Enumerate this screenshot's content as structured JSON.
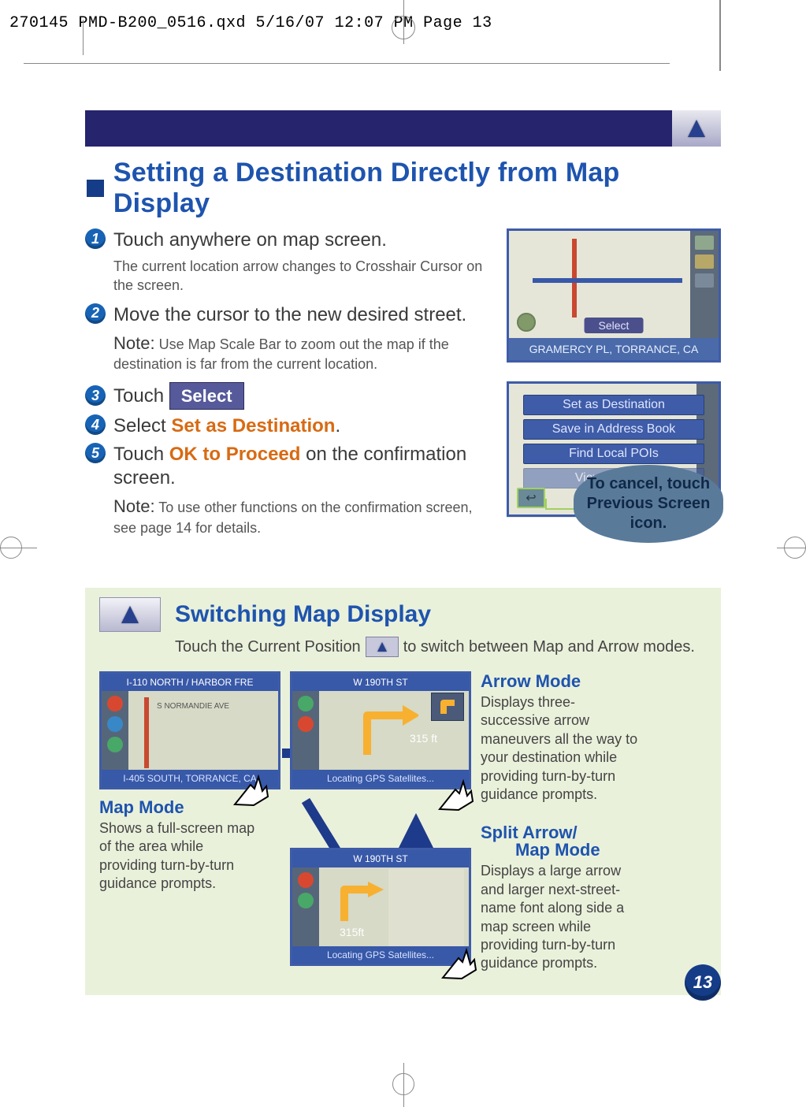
{
  "print_mark": "270145 PMD-B200_0516.qxd  5/16/07  12:07 PM  Page 13",
  "heading": "Setting a Destination Directly from Map Display",
  "steps": [
    {
      "num": "1",
      "title": "Touch anywhere on map screen.",
      "sub": "The current location arrow changes to Crosshair Cursor on the screen."
    },
    {
      "num": "2",
      "title": "Move the cursor to the new desired street.",
      "note_label": "Note:",
      "sub": "Use Map Scale Bar to zoom out the map if the destination is far from the current location."
    },
    {
      "num": "3",
      "title_pre": "Touch",
      "select_label": "Select"
    },
    {
      "num": "4",
      "title_pre": "Select",
      "orange": "Set as Destination",
      "title_post": "."
    },
    {
      "num": "5",
      "title_pre": "Touch",
      "orange": "OK to Proceed",
      "title_post": " on the confirmation screen.",
      "note_label": "Note:",
      "sub": "To use other functions on the confirmation screen, see page 14 for details."
    }
  ],
  "shot1": {
    "status": "GRAMERCY PL, TORRANCE, CA",
    "select_btn": "Select"
  },
  "shot2": {
    "menu": [
      "Set as Destination",
      "Save in Address Book",
      "Find Local POIs",
      "View Icon List"
    ],
    "callout": "To cancel, touch Previous Screen icon."
  },
  "section2": {
    "title": "Switching Map Display",
    "intro_pre": "Touch the Current Position",
    "intro_post": "to switch between Map and Arrow modes."
  },
  "map_mode": {
    "top": "I-110 NORTH / HARBOR FRE",
    "inner": "S NORMANDIE AVE",
    "bottom": "I-405 SOUTH, TORRANCE, CA",
    "label": "Map Mode",
    "desc": "Shows a full-screen map of the area while providing turn-by-turn guidance prompts."
  },
  "arrow_mode": {
    "top": "W 190TH ST",
    "dist": "315 ft",
    "bottom": "Locating GPS Satellites...",
    "label": "Arrow Mode",
    "desc": "Displays three-successive arrow maneuvers all the way to your destination while providing turn-by-turn guidance prompts."
  },
  "split_mode": {
    "top": "W 190TH ST",
    "dist": "315ft",
    "bottom": "Locating GPS Satellites...",
    "label1": "Split Arrow/",
    "label2": "Map Mode",
    "desc": "Displays a large arrow and larger next-street-name font along side a map screen while providing turn-by-turn guidance prompts."
  },
  "page_number": "13"
}
